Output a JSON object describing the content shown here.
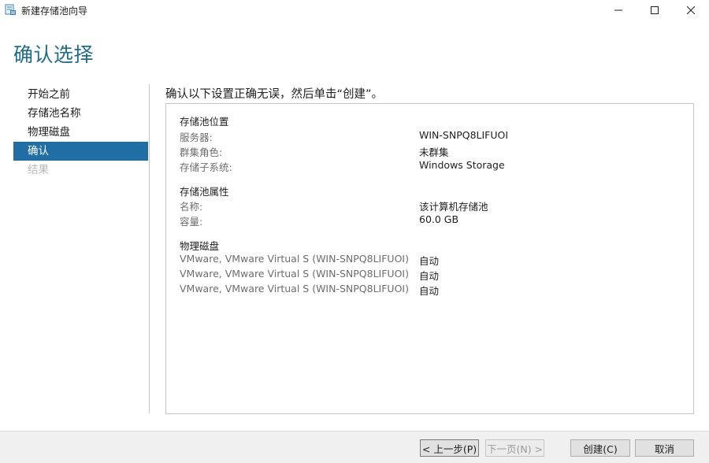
{
  "window": {
    "title": "新建存储池向导"
  },
  "page": {
    "title": "确认选择",
    "instruction": "确认以下设置正确无误，然后单击“创建”。"
  },
  "nav": {
    "items": [
      {
        "label": "开始之前",
        "state": "normal"
      },
      {
        "label": "存储池名称",
        "state": "normal"
      },
      {
        "label": "物理磁盘",
        "state": "normal"
      },
      {
        "label": "确认",
        "state": "active"
      },
      {
        "label": "结果",
        "state": "disabled"
      }
    ]
  },
  "summary": {
    "location": {
      "title": "存储池位置",
      "server_label": "服务器:",
      "server_value": "WIN-SNPQ8LIFUOI",
      "cluster_label": "群集角色:",
      "cluster_value": "未群集",
      "subsystem_label": "存储子系统:",
      "subsystem_value": "Windows Storage"
    },
    "properties": {
      "title": "存储池属性",
      "name_label": "名称:",
      "name_value": "该计算机存储池",
      "capacity_label": "容量:",
      "capacity_value": "60.0 GB"
    },
    "disks": {
      "title": "物理磁盘",
      "items": [
        {
          "name": "VMware, VMware Virtual S (WIN-SNPQ8LIFUOI)",
          "allocation": "自动"
        },
        {
          "name": "VMware, VMware Virtual S (WIN-SNPQ8LIFUOI)",
          "allocation": "自动"
        },
        {
          "name": "VMware, VMware Virtual S (WIN-SNPQ8LIFUOI)",
          "allocation": "自动"
        }
      ]
    }
  },
  "buttons": {
    "prev": "< 上一步(P)",
    "next": "下一页(N) >",
    "create": "创建(C)",
    "cancel": "取消"
  },
  "colors": {
    "title_blue": "#1f6c8c",
    "nav_active": "#1f6fa6"
  },
  "icons": {
    "app": "storage-pool-wizard-icon",
    "minimize": "minimize-icon",
    "maximize": "maximize-icon",
    "close": "close-icon"
  }
}
